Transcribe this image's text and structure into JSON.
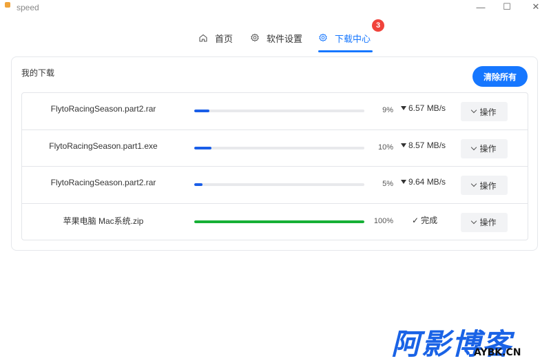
{
  "window": {
    "title": "speed",
    "controls": {
      "minimize": "—",
      "maximize": "☐",
      "close": "✕"
    }
  },
  "tabs": [
    {
      "label": "首页",
      "icon": "home-icon",
      "active": false
    },
    {
      "label": "软件设置",
      "icon": "gear-icon",
      "active": false
    },
    {
      "label": "下载中心",
      "icon": "gear-icon",
      "active": true,
      "badge": "3"
    }
  ],
  "downloads": {
    "title": "我的下载",
    "clear_all_label": "清除所有",
    "items": [
      {
        "filename": "FlytoRacingSeason.part2.rar",
        "progress": 9,
        "percent_label": "9%",
        "status": "6.57 MB/s",
        "status_icon": "download-arrow-icon",
        "action_label": "操作"
      },
      {
        "filename": "FlytoRacingSeason.part1.exe",
        "progress": 10,
        "percent_label": "10%",
        "status": "8.57 MB/s",
        "status_icon": "download-arrow-icon",
        "action_label": "操作"
      },
      {
        "filename": "FlytoRacingSeason.part2.rar",
        "progress": 5,
        "percent_label": "5%",
        "status": "9.64 MB/s",
        "status_icon": "download-arrow-icon",
        "action_label": "操作"
      },
      {
        "filename": "苹果电脑 Mac系统.zip",
        "progress": 100,
        "percent_label": "100%",
        "status": "完成",
        "status_icon": "check-icon",
        "action_label": "操作"
      }
    ]
  },
  "colors": {
    "accent": "#1677ff",
    "progress": "#1a5ee8",
    "progress_done": "#16b036",
    "badge": "#f0433b"
  },
  "watermark": {
    "cn": "阿影博客",
    "en": "AYBK.CN"
  }
}
